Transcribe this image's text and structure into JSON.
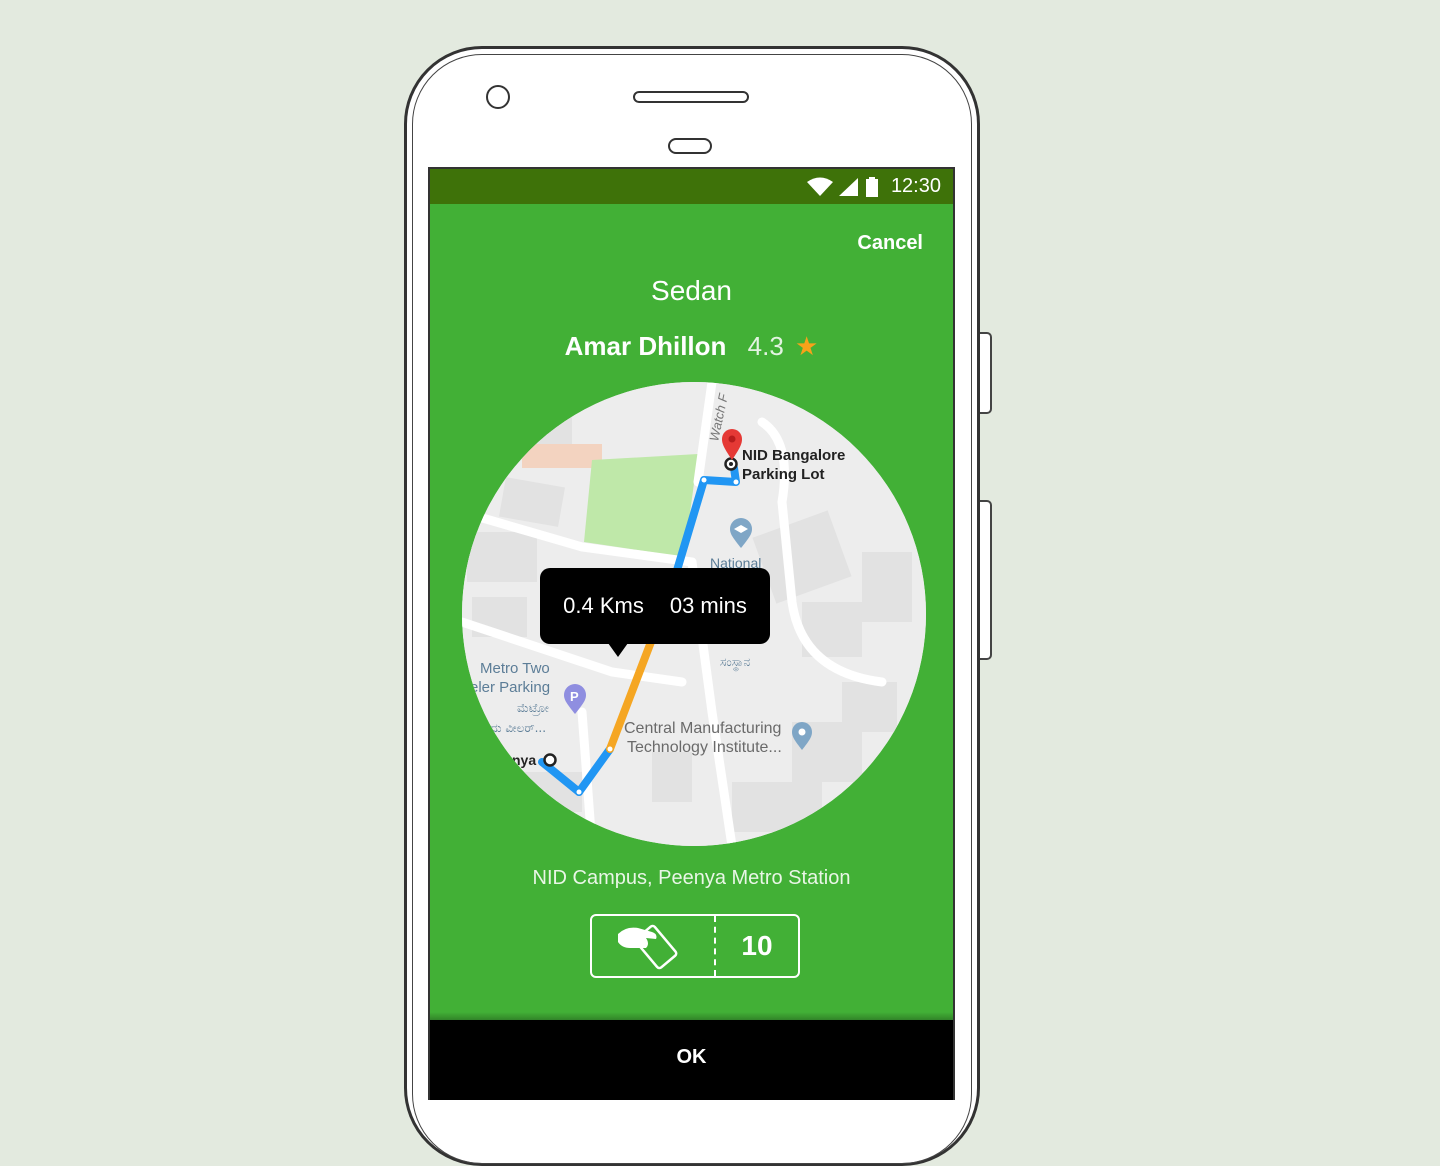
{
  "status_bar": {
    "time": "12:30"
  },
  "header": {
    "cancel_label": "Cancel"
  },
  "ride": {
    "vehicle_type": "Sedan",
    "driver_name": "Amar Dhillon",
    "driver_rating": "4.3",
    "star_glyph": "★"
  },
  "map": {
    "destination_label_line1": "NID Bangalore",
    "destination_label_line2": "Parking Lot",
    "street_label": "Watch F",
    "poi_national": "National",
    "poi_parking_line1": "Metro Two",
    "poi_parking_line2": "eler Parking",
    "poi_parking_kannada_1": "ಮೆಟ್ರೋ",
    "poi_parking_kannada_2": "ದು ವೀಲರ್...",
    "poi_kannada_sansthe": "ಸಂಸ್ಥಾನ",
    "poi_cmti_line1": "Central Manufacturing",
    "poi_cmti_line2": "Technology Institute...",
    "origin_label": "nya",
    "distance": "0.4 Kms",
    "duration": "03 mins",
    "route_colors": {
      "primary": "#2196f3",
      "traffic": "#f5a623"
    },
    "pin_color": "#e53935"
  },
  "route_text": "NID Campus, Peenya Metro Station",
  "fare": {
    "icon": "payment-card-hand-icon",
    "value": "10"
  },
  "footer": {
    "ok_label": "OK"
  },
  "colors": {
    "screen_bg": "#42b036",
    "status_bar": "#3e7209",
    "star": "#f7a21a"
  }
}
